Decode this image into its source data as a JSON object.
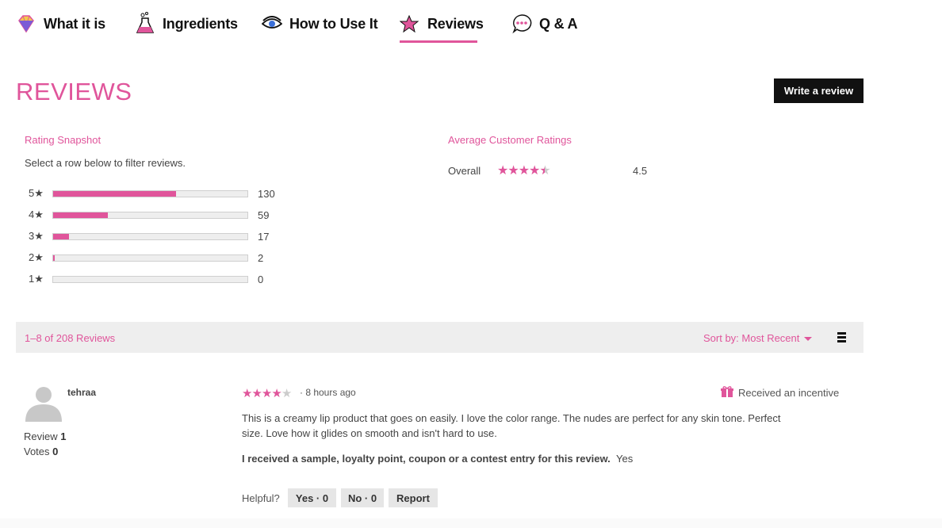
{
  "tabs": [
    {
      "label": "What it is",
      "icon": "diamond-icon"
    },
    {
      "label": "Ingredients",
      "icon": "flask-icon"
    },
    {
      "label": "How to Use It",
      "icon": "eye-icon"
    },
    {
      "label": "Reviews",
      "icon": "star-icon",
      "active": true
    },
    {
      "label": "Q & A",
      "icon": "speech-bubble-icon"
    }
  ],
  "reviews": {
    "title": "REVIEWS",
    "write_label": "Write a review"
  },
  "snapshot": {
    "title": "Rating Snapshot",
    "subtitle": "Select a row below to filter reviews.",
    "rows": [
      {
        "label": "5★",
        "count": "130",
        "fraction": 0.634
      },
      {
        "label": "4★",
        "count": "59",
        "fraction": 0.283
      },
      {
        "label": "3★",
        "count": "17",
        "fraction": 0.082
      },
      {
        "label": "2★",
        "count": "2",
        "fraction": 0.008
      },
      {
        "label": "1★",
        "count": "0",
        "fraction": 0.0
      }
    ]
  },
  "average": {
    "title": "Average Customer Ratings",
    "label": "Overall",
    "value": "4.5",
    "stars": 4.5
  },
  "toolbar": {
    "count": "1–8 of 208 Reviews",
    "sort": "Sort by: Most Recent"
  },
  "review": {
    "name": "tehraa",
    "review_label": "Review",
    "review_count": "1",
    "votes_label": "Votes",
    "votes_count": "0",
    "rating": 4,
    "time": "· 8 hours ago",
    "incentive": "Received an incentive",
    "text": "This is a creamy lip product that goes on easily. I love the color range. The nudes are perfect for any skin tone. Perfect size. Love how it glides on smooth and isn't hard to use.",
    "question": "I received a sample, loyalty point, coupon or a contest entry for this review.",
    "answer": "Yes",
    "helpful": "Helpful?",
    "yes_label": "Yes · 0",
    "no_label": "No · 0",
    "report_label": "Report"
  },
  "colors": {
    "accent": "#e0559b",
    "dark": "#111111",
    "toolbar_bg": "#eeeeee"
  }
}
